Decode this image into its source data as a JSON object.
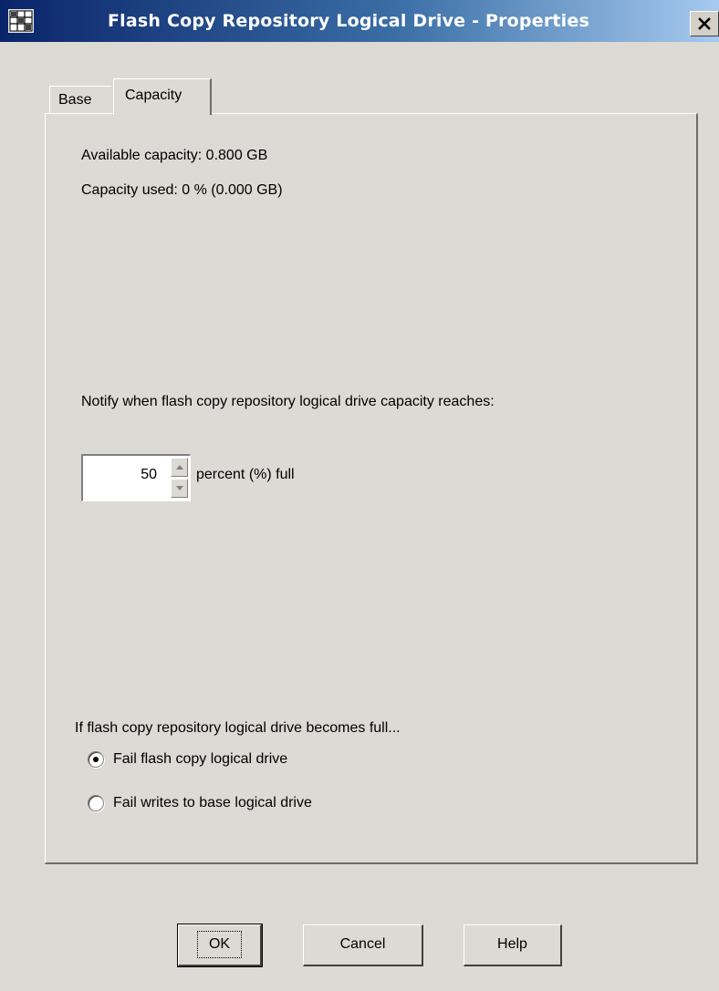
{
  "window": {
    "title": "Flash Copy Repository Logical Drive - Properties",
    "close_glyph": "✕",
    "icon": "grid-window-icon"
  },
  "tabs": [
    {
      "label": "Base",
      "selected": false
    },
    {
      "label": "Capacity",
      "selected": true
    }
  ],
  "capacity": {
    "available": "Available capacity: 0.800 GB",
    "used": "Capacity used: 0 % (0.000 GB)"
  },
  "notify": {
    "label": "Notify when flash copy repository logical drive capacity reaches:",
    "value": "50",
    "suffix": "percent (%) full"
  },
  "full_policy": {
    "label": "If flash copy repository logical drive becomes full...",
    "options": [
      {
        "label": "Fail flash copy logical drive",
        "selected": true
      },
      {
        "label": "Fail writes to base logical drive",
        "selected": false
      }
    ]
  },
  "buttons": {
    "ok": "OK",
    "cancel": "Cancel",
    "help": "Help"
  }
}
